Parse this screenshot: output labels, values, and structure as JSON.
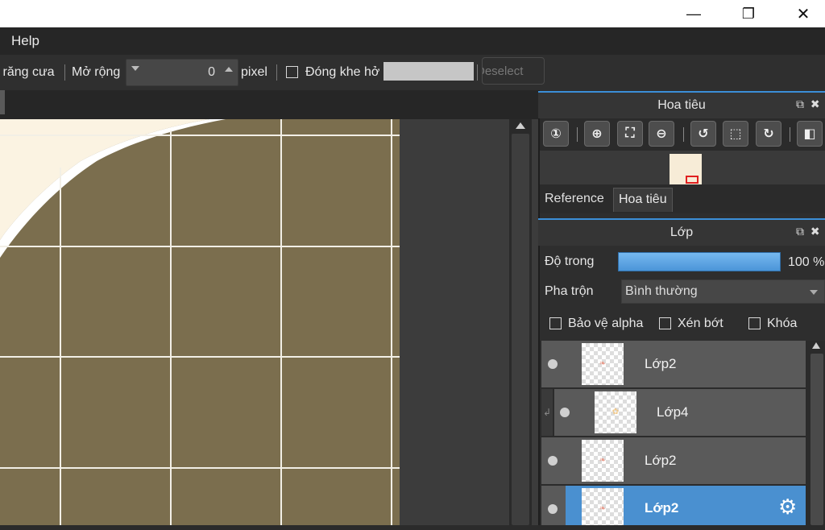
{
  "window": {
    "minimize_glyph": "—",
    "restore_glyph": "❐",
    "close_glyph": "✕"
  },
  "menu": {
    "help": "Help"
  },
  "toolbar": {
    "antialias_label": "' răng cưa",
    "expand_label": "Mở rộng",
    "expand_value": "0",
    "unit_label": "pixel",
    "close_gap_label": "Đóng khe hở",
    "deselect_label": "Deselect"
  },
  "navigator": {
    "title": "Hoa tiêu",
    "tab_reference": "Reference",
    "tab_navigator": "Hoa tiêu",
    "icons": [
      "zoom-actual-icon",
      "zoom-in-icon",
      "fit-screen-icon",
      "zoom-out-icon",
      "rotate-left-icon",
      "fullscreen-icon",
      "rotate-right-icon",
      "flip-icon"
    ]
  },
  "layers_panel": {
    "title": "Lớp",
    "opacity_label": "Độ trong",
    "opacity_value": "100 %",
    "opacity_fraction": 1.0,
    "blend_label": "Pha trộn",
    "blend_value": "Bình thường",
    "protect_alpha_label": "Bảo vệ alpha",
    "clipping_label": "Xén bớt",
    "lock_label": "Khóa",
    "layers": [
      {
        "name": "Lớp2",
        "selected": false
      },
      {
        "name": "Lớp4",
        "selected": false
      },
      {
        "name": "Lớp2",
        "selected": false
      },
      {
        "name": "Lớp2",
        "selected": true
      }
    ]
  },
  "colors": {
    "canvas_fill": "#7b6e4e",
    "grid_line": "#f2efe6",
    "accent": "#4a90d0"
  }
}
